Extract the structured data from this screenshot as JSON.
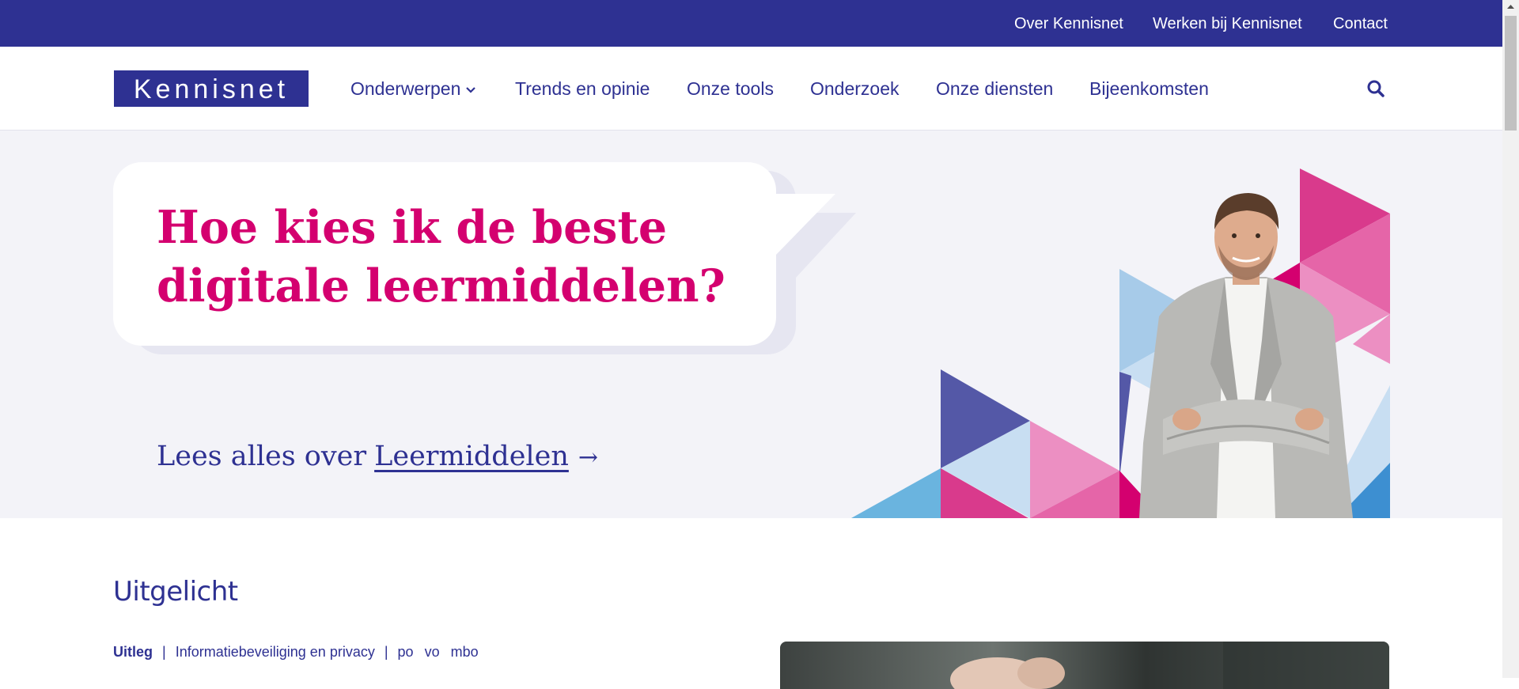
{
  "topbar": {
    "links": [
      "Over Kennisnet",
      "Werken bij Kennisnet",
      "Contact"
    ]
  },
  "nav": {
    "logo": "Kennisnet",
    "items": [
      "Onderwerpen",
      "Trends en opinie",
      "Onze tools",
      "Onderzoek",
      "Onze diensten",
      "Bijeenkomsten"
    ],
    "search_icon": "search-icon"
  },
  "hero": {
    "title": "Hoe kies ik de beste digitale leermiddelen?",
    "link_prefix": "Lees alles over",
    "link_text": "Leermiddelen",
    "arrow": "→"
  },
  "featured": {
    "heading": "Uitgelicht",
    "type": "Uitleg",
    "topic": "Informatiebeveiliging en privacy",
    "levels": [
      "po",
      "vo",
      "mbo"
    ],
    "separator": "|"
  },
  "colors": {
    "brand": "#2e3192",
    "accent": "#d4006f",
    "hero_bg": "#f3f3f8"
  }
}
